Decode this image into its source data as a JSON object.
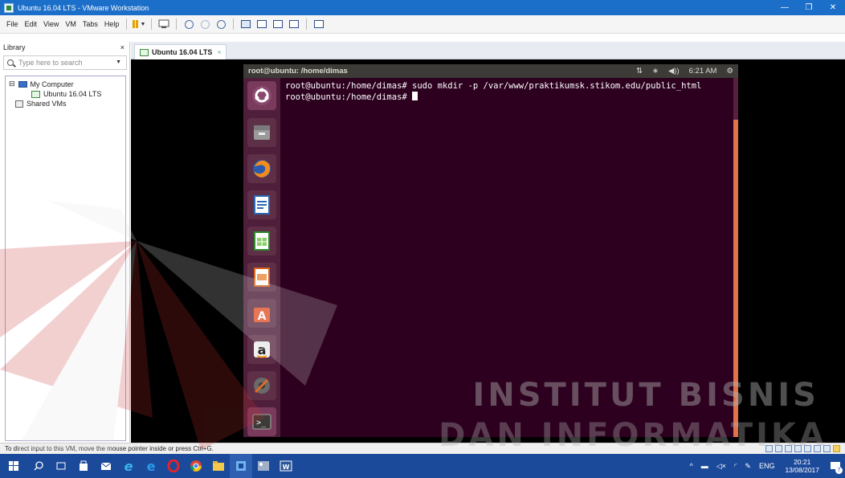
{
  "window": {
    "title": "Ubuntu 16.04 LTS - VMware Workstation",
    "controls": {
      "minimize": "—",
      "maximize": "❐",
      "close": "✕"
    }
  },
  "menu": {
    "items": [
      "File",
      "Edit",
      "View",
      "VM",
      "Tabs",
      "Help"
    ],
    "toolbar_icons": [
      "pause-icon",
      "send-ctrl-alt-del-icon",
      "snapshot-icon",
      "revert-snapshot-icon",
      "snapshot-manager-icon",
      "show-library-icon",
      "show-thumbnail-bar-icon",
      "full-screen-icon",
      "unity-icon",
      "console-view-icon"
    ]
  },
  "library": {
    "header": "Library",
    "close": "×",
    "search_placeholder": "Type here to search",
    "tree": {
      "expander": "⊟",
      "root": "My Computer",
      "vm": "Ubuntu 16.04 LTS",
      "shared": "Shared VMs"
    }
  },
  "tabs": [
    {
      "label": "Ubuntu 16.04 LTS",
      "close": "×"
    }
  ],
  "ubuntu": {
    "panel_title": "root@ubuntu: /home/dimas",
    "indicators": {
      "network": "⇅",
      "bluetooth": "∗",
      "volume": "◀))",
      "time": "6:21 AM",
      "settings": "⚙"
    },
    "launcher_icons": [
      "ubuntu-dash-icon",
      "files-icon",
      "firefox-icon",
      "libreoffice-writer-icon",
      "libreoffice-calc-icon",
      "libreoffice-impress-icon",
      "ubuntu-software-icon",
      "amazon-icon",
      "system-settings-icon",
      "terminal-icon"
    ],
    "terminal": {
      "line1": "root@ubuntu:/home/dimas# sudo mkdir -p /var/www/praktikumsk.stikom.edu/public_html",
      "line2": "root@ubuntu:/home/dimas# "
    }
  },
  "statusbar": {
    "message": "To direct input to this VM, move the mouse pointer inside or press Ctrl+G."
  },
  "taskbar": {
    "apps": [
      "windows-start-icon",
      "search-icon",
      "task-view-icon",
      "store-icon",
      "mail-icon",
      "edge-icon",
      "ie-icon",
      "opera-icon",
      "chrome-icon",
      "file-explorer-icon",
      "vmware-icon",
      "photos-icon",
      "word-icon"
    ],
    "tray": {
      "chevron": "^",
      "lang": "ENG",
      "time": "20:21",
      "date": "13/08/2017",
      "notifications": "7"
    }
  },
  "watermark": {
    "line1": "INSTITUT BISNIS",
    "line2": "DAN INFORMATIKA"
  }
}
